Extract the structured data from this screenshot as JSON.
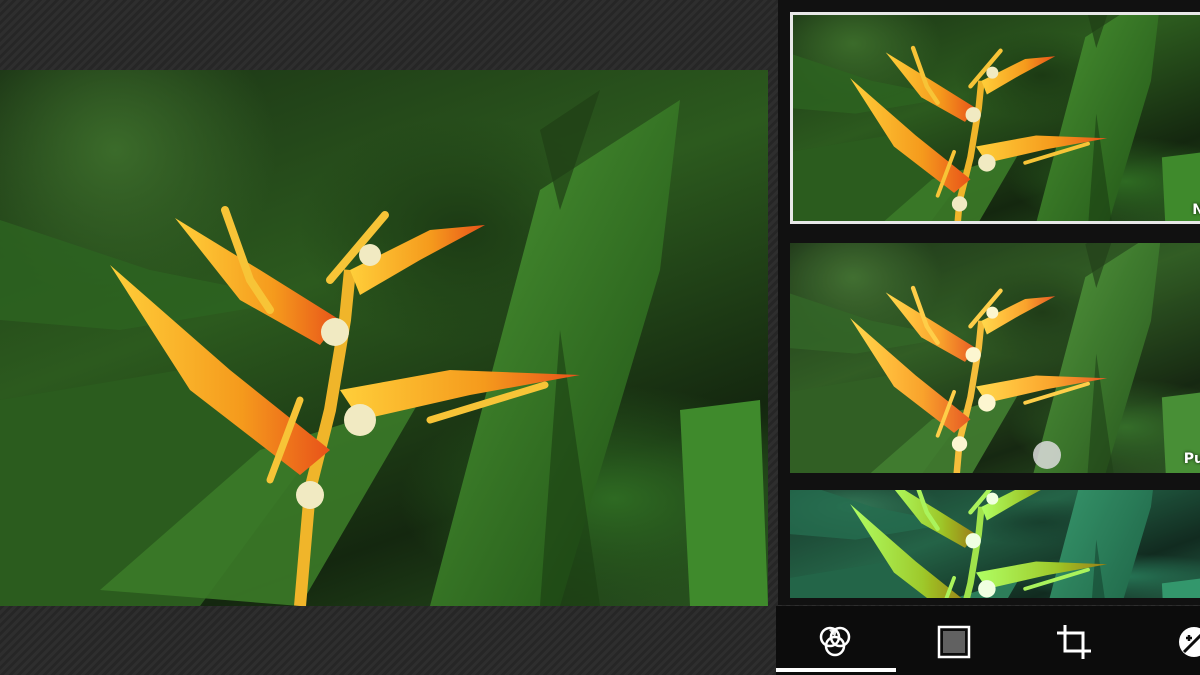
{
  "filters": {
    "items": [
      {
        "label": "N",
        "selected": true
      },
      {
        "label": "Pu",
        "selected": false
      },
      {
        "label": "",
        "selected": false
      }
    ]
  },
  "toolbar": {
    "tools": [
      {
        "icon": "filters-icon",
        "active": true
      },
      {
        "icon": "frame-icon",
        "active": false
      },
      {
        "icon": "crop-icon",
        "active": false
      },
      {
        "icon": "adjust-icon",
        "active": false
      }
    ]
  },
  "colors": {
    "accent": "#ffffff",
    "petal": "#f4a21e",
    "leaf": "#2f6b22"
  }
}
